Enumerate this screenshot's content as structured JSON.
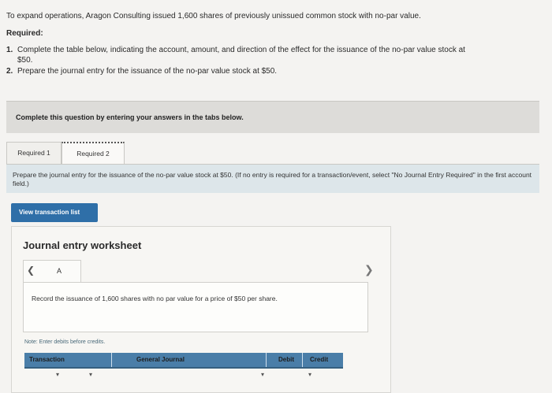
{
  "problem": {
    "intro": "To expand operations, Aragon Consulting issued 1,600 shares of previously unissued common stock with no-par value.",
    "required_heading": "Required:",
    "requirements": [
      {
        "num": "1.",
        "text": "Complete the table below, indicating the account, amount, and direction of the effect for the issuance of the no-par value stock at",
        "cont": "$50."
      },
      {
        "num": "2.",
        "text": "Prepare the journal entry for the issuance of the no-par value stock at $50.",
        "cont": ""
      }
    ]
  },
  "instruction_bar": "Complete this question by entering your answers in the tabs below.",
  "tabs": [
    {
      "label": "Required 1"
    },
    {
      "label": "Required 2"
    }
  ],
  "prompt": "Prepare the journal entry for the issuance of the no-par value stock at $50. (If no entry is required for a transaction/event, select \"No Journal Entry Required\" in the first account field.)",
  "view_button": "View transaction list",
  "worksheet": {
    "title": "Journal entry worksheet",
    "nav_label": "A",
    "description": "Record the issuance of 1,600 shares with no par value for a price of $50 per share.",
    "note": "Note: Enter debits before credits.",
    "columns": [
      "Transaction",
      "General Journal",
      "Debit",
      "Credit"
    ]
  },
  "icons": {
    "prev": "chevron-left-icon",
    "next": "chevron-right-icon"
  },
  "colors": {
    "accent": "#2f6fa8",
    "table_header": "#4a7ea8",
    "prompt_bg": "#dde6ea"
  }
}
